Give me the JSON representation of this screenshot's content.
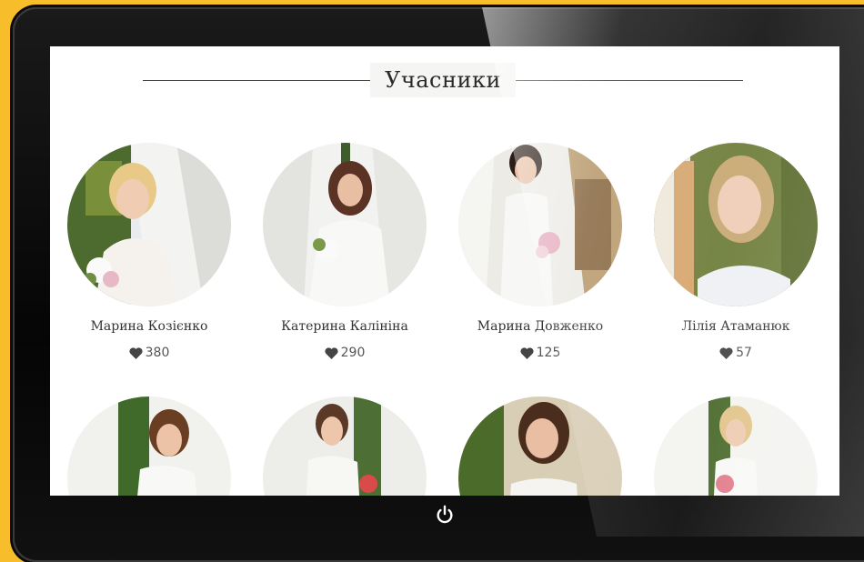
{
  "section": {
    "title": "Учасники"
  },
  "participants": [
    {
      "name": "Марина Козієнко",
      "likes": "380",
      "icon": "heart-icon"
    },
    {
      "name": "Катерина Калініна",
      "likes": "290",
      "icon": "heart-icon"
    },
    {
      "name": "Марина Довженко",
      "likes": "125",
      "icon": "heart-icon"
    },
    {
      "name": "Лілія Атаманюк",
      "likes": "57",
      "icon": "heart-icon"
    }
  ],
  "second_row_count_visible": 4,
  "device": {
    "button_icon": "power-icon"
  },
  "colors": {
    "background": "#f7bd2b",
    "bezel": "#0b0b0b",
    "screen": "#ffffff",
    "heart": "#444444"
  }
}
